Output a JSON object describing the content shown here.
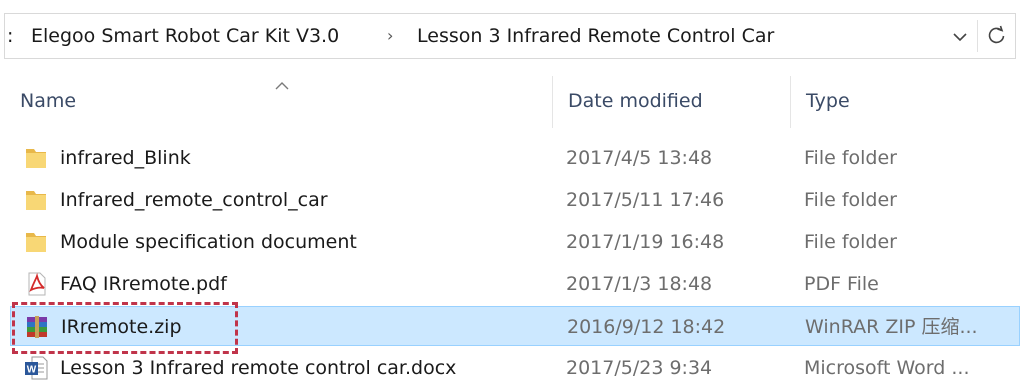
{
  "address_bar": {
    "lead": ":",
    "crumbs": [
      "Elegoo Smart Robot Car Kit V3.0",
      "Lesson 3 Infrared Remote Control Car"
    ],
    "separator": "›",
    "dropdown_icon": "chevron-down-icon",
    "refresh_icon": "refresh-icon"
  },
  "columns": {
    "name": "Name",
    "date": "Date modified",
    "type": "Type"
  },
  "files": [
    {
      "name": "infrared_Blink",
      "date": "2017/4/5 13:48",
      "type": "File folder",
      "icon": "folder-icon"
    },
    {
      "name": "Infrared_remote_control_car",
      "date": "2017/5/11 17:46",
      "type": "File folder",
      "icon": "folder-icon"
    },
    {
      "name": "Module specification document",
      "date": "2017/1/19 16:48",
      "type": "File folder",
      "icon": "folder-icon"
    },
    {
      "name": "FAQ IRremote.pdf",
      "date": "2017/1/3 18:48",
      "type": "PDF File",
      "icon": "pdf-icon"
    },
    {
      "name": "IRremote.zip",
      "date": "2016/9/12 18:42",
      "type": "WinRAR ZIP 压缩...",
      "icon": "winrar-icon",
      "selected": true
    },
    {
      "name": "Lesson 3 Infrared remote control car.docx",
      "date": "2017/5/23 9:34",
      "type": "Microsoft Word ...",
      "icon": "word-icon"
    }
  ],
  "colors": {
    "selection_bg": "#cce8ff",
    "selection_border": "#99d1ff",
    "annotation": "#c0344a",
    "folder": "#f8d775"
  }
}
